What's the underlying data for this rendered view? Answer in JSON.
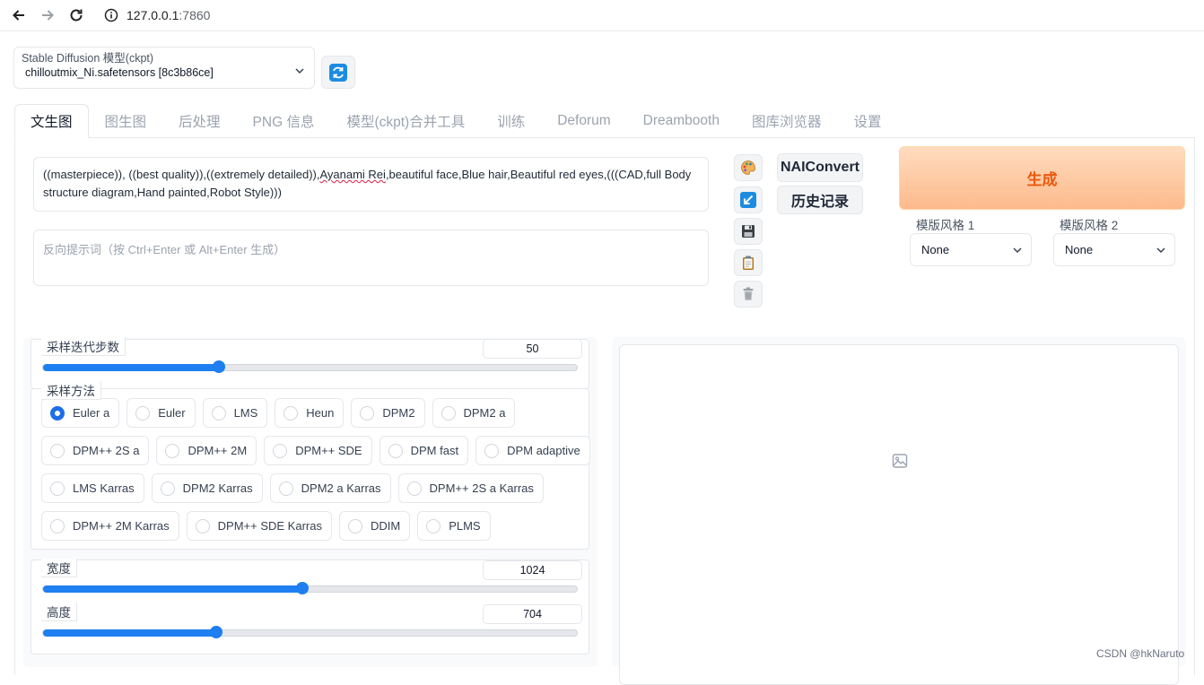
{
  "browser": {
    "url_host": "127.0.0.1",
    "url_port": ":7860"
  },
  "model": {
    "label": "Stable Diffusion 模型(ckpt)",
    "value": "chilloutmix_Ni.safetensors [8c3b86ce]"
  },
  "tabs": [
    {
      "label": "文生图",
      "active": true
    },
    {
      "label": "图生图"
    },
    {
      "label": "后处理"
    },
    {
      "label": "PNG 信息"
    },
    {
      "label": "模型(ckpt)合并工具"
    },
    {
      "label": "训练"
    },
    {
      "label": "Deforum"
    },
    {
      "label": "Dreambooth"
    },
    {
      "label": "图库浏览器"
    },
    {
      "label": "设置"
    }
  ],
  "prompt": {
    "part1": "((masterpiece)), ((best quality)),((extremely detailed)),",
    "part2": "Ayanami Rei",
    "part3": ",beautiful face,Blue hair,Beautiful red eyes,(((CAD,full Body structure diagram,Hand painted,Robot Style)))"
  },
  "negative_prompt": {
    "placeholder": "反向提示词（按 Ctrl+Enter 或 Alt+Enter 生成）"
  },
  "buttons": {
    "naiconvert": "NAIConvert",
    "history": "历史记录",
    "generate": "生成"
  },
  "styles": [
    {
      "label": "模版风格 1",
      "value": "None"
    },
    {
      "label": "模版风格 2",
      "value": "None"
    }
  ],
  "steps": {
    "label": "采样迭代步数",
    "value": "50",
    "fraction": 0.33
  },
  "sampler": {
    "label": "采样方法",
    "options": [
      "Euler a",
      "Euler",
      "LMS",
      "Heun",
      "DPM2",
      "DPM2 a",
      "DPM++ 2S a",
      "DPM++ 2M",
      "DPM++ SDE",
      "DPM fast",
      "DPM adaptive",
      "LMS Karras",
      "DPM2 Karras",
      "DPM2 a Karras",
      "DPM++ 2S a Karras",
      "DPM++ 2M Karras",
      "DPM++ SDE Karras",
      "DDIM",
      "PLMS"
    ],
    "selected": "Euler a"
  },
  "width": {
    "label": "宽度",
    "value": "1024",
    "fraction": 0.485
  },
  "height": {
    "label": "高度",
    "value": "704",
    "fraction": 0.325
  },
  "watermark": "CSDN @hkNaruto",
  "colors": {
    "accent": "#1d7ff0",
    "generate": "#ea580c"
  }
}
